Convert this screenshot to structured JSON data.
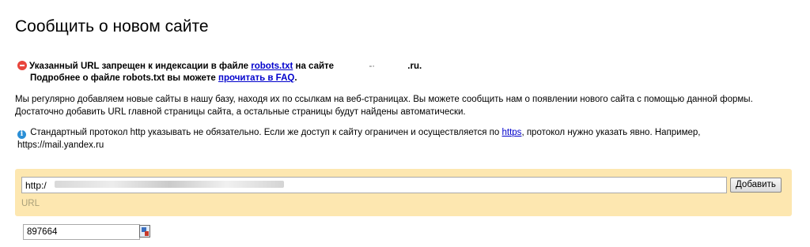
{
  "page": {
    "title": "Сообщить о новом сайте"
  },
  "error": {
    "line1_prefix": "Указанный URL запрещен к индексации в файле",
    "robots_link": "robots.txt",
    "line1_middle": "на сайте",
    "domain_mask": "-·",
    "domain_suffix": ".ru.",
    "line2_prefix": "Подробнее о файле robots.txt вы можете",
    "faq_link": "прочитать в FAQ",
    "line2_suffix": "."
  },
  "info": {
    "text": "Мы регулярно добавляем новые сайты в нашу базу, находя их по ссылкам на веб-страницах. Вы можете сообщить нам о появлении нового сайта с помощью данной формы. Достаточно добавить URL главной страницы сайта, а остальные страницы будут найдены автоматически."
  },
  "note": {
    "icon_glyph": "i",
    "text_before": "Стандартный протокол http указывать не обязательно. Если же доступ к сайту ограничен и осуществляется по",
    "https_link": "https",
    "text_after": ", протокол нужно указать явно. Например,",
    "example": "https://mail.yandex.ru"
  },
  "form": {
    "url_value": "http:/",
    "add_button_label": "Добавить",
    "url_label": "URL",
    "captcha_value": "897664"
  }
}
